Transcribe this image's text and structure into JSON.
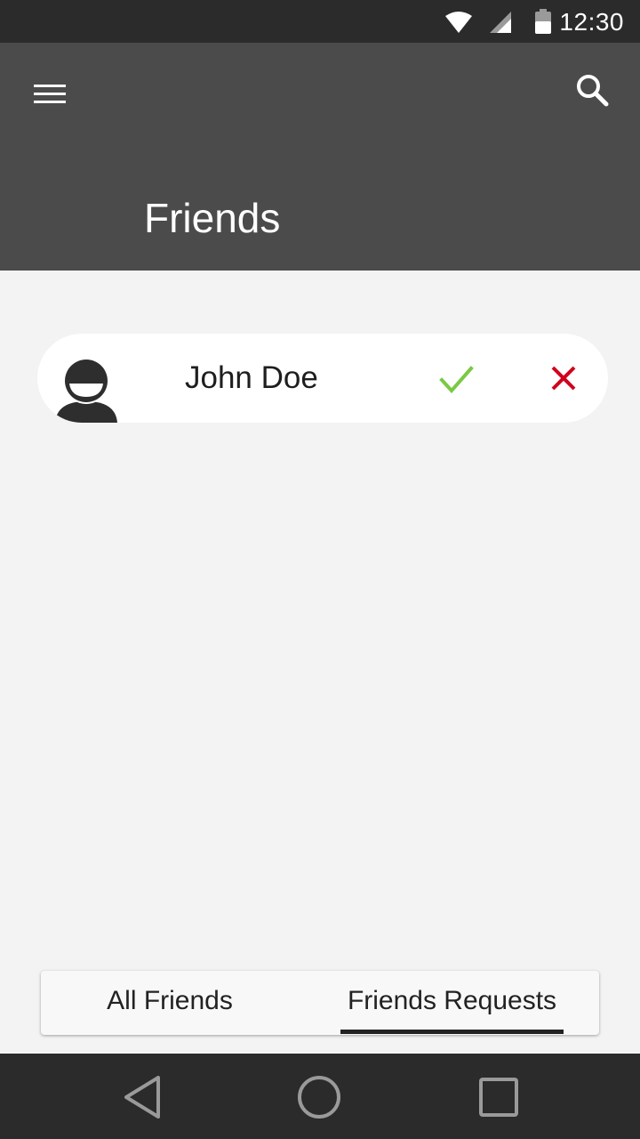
{
  "status_bar": {
    "time": "12:30",
    "icons": [
      "wifi-icon",
      "cellular-signal-icon",
      "battery-icon"
    ]
  },
  "app_bar": {
    "title": "Friends",
    "menu_icon": "hamburger-menu-icon",
    "search_icon": "search-icon",
    "background": "#4b4b4b"
  },
  "friend_requests": [
    {
      "name": "John Doe",
      "avatar_icon": "person-avatar-icon",
      "accept_icon": "checkmark-icon",
      "decline_icon": "close-icon"
    }
  ],
  "tabs": [
    {
      "label": "All Friends",
      "selected": false
    },
    {
      "label": "Friends Requests",
      "selected": true
    }
  ],
  "colors": {
    "accept": "#7ac943",
    "decline": "#d0021b",
    "status_bar": "#2b2b2b",
    "background": "#f3f3f3"
  },
  "nav_bar": {
    "icons": [
      "back-icon",
      "home-icon",
      "recents-icon"
    ]
  }
}
